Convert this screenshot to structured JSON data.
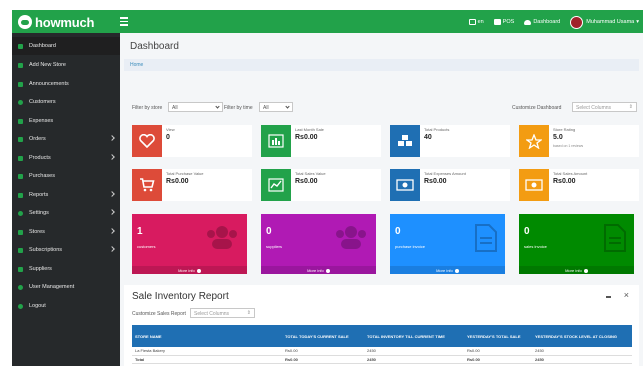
{
  "header": {
    "logo": "howmuch",
    "nav": [
      {
        "label": "en",
        "icon": "flag-icon"
      },
      {
        "label": "POS",
        "icon": "pos-icon"
      },
      {
        "label": "Dashboard",
        "icon": "cloud-icon"
      },
      {
        "label": "Muhammad Usama",
        "icon": "avatar"
      }
    ],
    "accent_color": "#22a24a"
  },
  "sidebar": {
    "items": [
      {
        "label": "Dashboard",
        "has_submenu": false,
        "active": true
      },
      {
        "label": "Add New Store",
        "has_submenu": false
      },
      {
        "label": "Announcements",
        "has_submenu": false
      },
      {
        "label": "Customers",
        "has_submenu": false
      },
      {
        "label": "Expenses",
        "has_submenu": false
      },
      {
        "label": "Orders",
        "has_submenu": true
      },
      {
        "label": "Products",
        "has_submenu": true
      },
      {
        "label": "Purchases",
        "has_submenu": false
      },
      {
        "label": "Reports",
        "has_submenu": true
      },
      {
        "label": "Settings",
        "has_submenu": true
      },
      {
        "label": "Stores",
        "has_submenu": true
      },
      {
        "label": "Subscriptions",
        "has_submenu": true
      },
      {
        "label": "Suppliers",
        "has_submenu": false
      },
      {
        "label": "User Management",
        "has_submenu": false
      },
      {
        "label": "Logout",
        "has_submenu": false
      }
    ]
  },
  "main": {
    "title": "Dashboard",
    "breadcrumb": "Home",
    "filters": {
      "store_label": "Filter by store",
      "store_value": "All",
      "time_label": "Filter by time",
      "time_value": "All",
      "customize_label": "Customize Dashboard",
      "customize_placeholder": "Select Columns"
    },
    "info_boxes": [
      {
        "label": "View",
        "value": "0",
        "sub": "",
        "color": "#dd4b39",
        "icon": "heart-icon"
      },
      {
        "label": "Last Month Sale",
        "value": "Rs0.00",
        "sub": "",
        "color": "#22a24a",
        "icon": "bar-chart-icon"
      },
      {
        "label": "Total Products",
        "value": "40",
        "sub": "",
        "color": "#1f6fb3",
        "icon": "cubes-icon"
      },
      {
        "label": "Store Rating",
        "value": "5.0",
        "sub": "based on 1 reviews",
        "color": "#f39c12",
        "icon": "star-icon"
      },
      {
        "label": "Total Purchase Value",
        "value": "Rs0.00",
        "sub": "",
        "color": "#dd4b39",
        "icon": "cart-icon"
      },
      {
        "label": "Total Sales Value",
        "value": "Rs0.00",
        "sub": "",
        "color": "#22a24a",
        "icon": "line-chart-icon"
      },
      {
        "label": "Total Expenses Amount",
        "value": "Rs0.00",
        "sub": "",
        "color": "#1f6fb3",
        "icon": "money-icon"
      },
      {
        "label": "Total Sales Amount",
        "value": "Rs0.00",
        "sub": "",
        "color": "#f39c12",
        "icon": "money-icon"
      }
    ],
    "small_boxes": [
      {
        "number": "1",
        "label": "customers",
        "footer": "More info",
        "color": "#d81b60",
        "icon": "users-icon"
      },
      {
        "number": "0",
        "label": "suppliers",
        "footer": "More info",
        "color": "#b01ab4",
        "icon": "users-icon"
      },
      {
        "number": "0",
        "label": "purchase invoice",
        "footer": "More info",
        "color": "#1e90ff",
        "icon": "file-icon"
      },
      {
        "number": "0",
        "label": "sales invoice",
        "footer": "More info",
        "color": "#008a00",
        "icon": "file-icon"
      }
    ]
  },
  "report": {
    "title": "Sale Inventory Report",
    "customize_label": "Customize Sales Report",
    "customize_placeholder": "Select Columns",
    "columns": [
      "STORE NAME",
      "TOTAL TODAY'S CURRENT SALE",
      "TOTAL INVENTORY TILL CURRENT TIME",
      "YESTERDAY'S TOTAL SALE",
      "YESTERDAY'S STOCK LEVEL AT CLOSING"
    ],
    "rows": [
      {
        "store": "La Fiesta Bakery",
        "today_sale": "Rs0.00",
        "inventory": "2450",
        "yesterday_sale": "Rs0.00",
        "stock_closing": "2450"
      },
      {
        "store": "Total",
        "today_sale": "Rs0.00",
        "inventory": "2450",
        "yesterday_sale": "Rs0.00",
        "stock_closing": "2450"
      }
    ]
  }
}
